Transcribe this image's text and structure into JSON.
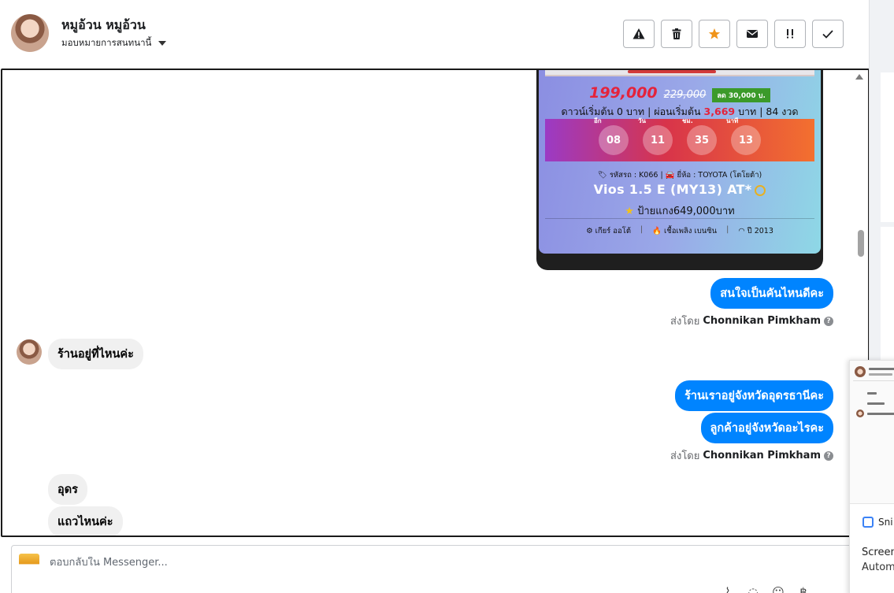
{
  "header": {
    "contact_name": "หมูอ้วน หมูอ้วน",
    "assign_label": "มอบหมายการสนทนานี้",
    "actions": [
      {
        "name": "report-button",
        "icon": "warning-icon",
        "glyph": "!"
      },
      {
        "name": "delete-button",
        "icon": "trash-icon",
        "glyph": ""
      },
      {
        "name": "star-button",
        "icon": "star-icon",
        "glyph": "★"
      },
      {
        "name": "mark-unread-button",
        "icon": "envelope-icon",
        "glyph": ""
      },
      {
        "name": "follow-up-button",
        "icon": "follow-up-icon",
        "glyph": "!!"
      },
      {
        "name": "mark-done-button",
        "icon": "check-icon",
        "glyph": "✓"
      }
    ]
  },
  "car_card": {
    "price": "199,000",
    "old_price": "229,000",
    "discount": "ลด 30,000 บ.",
    "terms_prefix": "ดาวน์เริ่มต้น 0 บาท | ผ่อนเริ่มต้น ",
    "terms_amount": "3,669",
    "terms_suffix": " บาท | 84 งวด",
    "countdown": [
      {
        "label": "อีก",
        "value": "08"
      },
      {
        "label": "วัน",
        "value": "11"
      },
      {
        "label": "ชม.",
        "value": "35"
      },
      {
        "label": "นาที",
        "value": "13"
      }
    ],
    "meta": "🏷 รหัสรถ : K066 | 🚘 ยี่ห้อ : TOYOTA (โตโยต้า)",
    "model": "Vios 1.5 E (MY13) AT*",
    "plate": "ป้ายแกง649,000บาท",
    "spec_gear": "⚙ เกียร์ ออโต้",
    "spec_fuel": "🔥 เชื้อเพลิง เบนซิน",
    "spec_year": "◠ ปี 2013"
  },
  "messages": {
    "out1": "สนใจเป็นคันไหนดีคะ",
    "in1": "ร้านอยู่ที่ไหนค่ะ",
    "out2": "ร้านเราอยู่จังหวัดอุดรธานีคะ",
    "out3": "ลูกค้าอยู่จังหวัดอะไรคะ",
    "in2": "อุดร",
    "in3": "แถวไหนค่ะ"
  },
  "sent_by": {
    "prefix": "ส่งโดย",
    "agent": "Chonnikan Pimkham"
  },
  "composer": {
    "placeholder": "ตอบกลับใน Messenger..."
  },
  "snip_popup": {
    "app_label": "Sni",
    "title": "Screen",
    "subtitle": "Autom"
  },
  "colors": {
    "outgoing_bubble": "#0084ff",
    "incoming_bubble": "#f0f0f0",
    "price_red": "#e4233b",
    "star_orange": "#f0941a"
  }
}
